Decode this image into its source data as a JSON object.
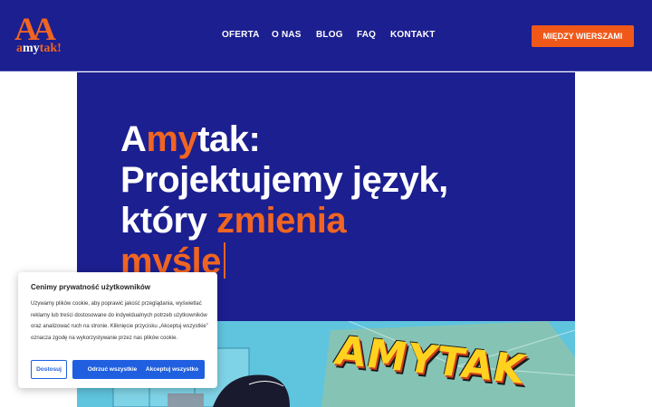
{
  "logo": {
    "letters": "AA",
    "part1": "a",
    "part2": "my",
    "part3": "tak!"
  },
  "nav": {
    "items": [
      "OFERTA",
      "O NAS",
      "BLOG",
      "FAQ",
      "KONTAKT"
    ]
  },
  "cta": {
    "label": "MIĘDZY WIERSZAMI"
  },
  "hero": {
    "line1_a": "A",
    "line1_my": "my",
    "line1_rest": "tak:",
    "line2": "Projektujemy język,",
    "line3_a": "który ",
    "line3_b": "zmienia",
    "line4": "myśle"
  },
  "comic": {
    "title": "AMYTAK"
  },
  "cookie": {
    "title": "Cenimy prywatność użytkowników",
    "text": "Używamy plików cookie, aby poprawić jakość przeglądania, wyświetlać reklamy lub treści dostosowane do indywidualnych potrzeb użytkowników oraz analizować ruch na stronie. Kliknięcie przycisku „Akceptuj wszystkie” oznacza zgodę na wykorzystywanie przez nas plików cookie.",
    "btn_customize": "Dostosuj",
    "btn_reject": "Odrzuć wszystkie",
    "btn_accept": "Akceptuj wszystko"
  },
  "colors": {
    "navy": "#1c1f8f",
    "orange": "#f06522",
    "blue": "#1f5fe0"
  }
}
